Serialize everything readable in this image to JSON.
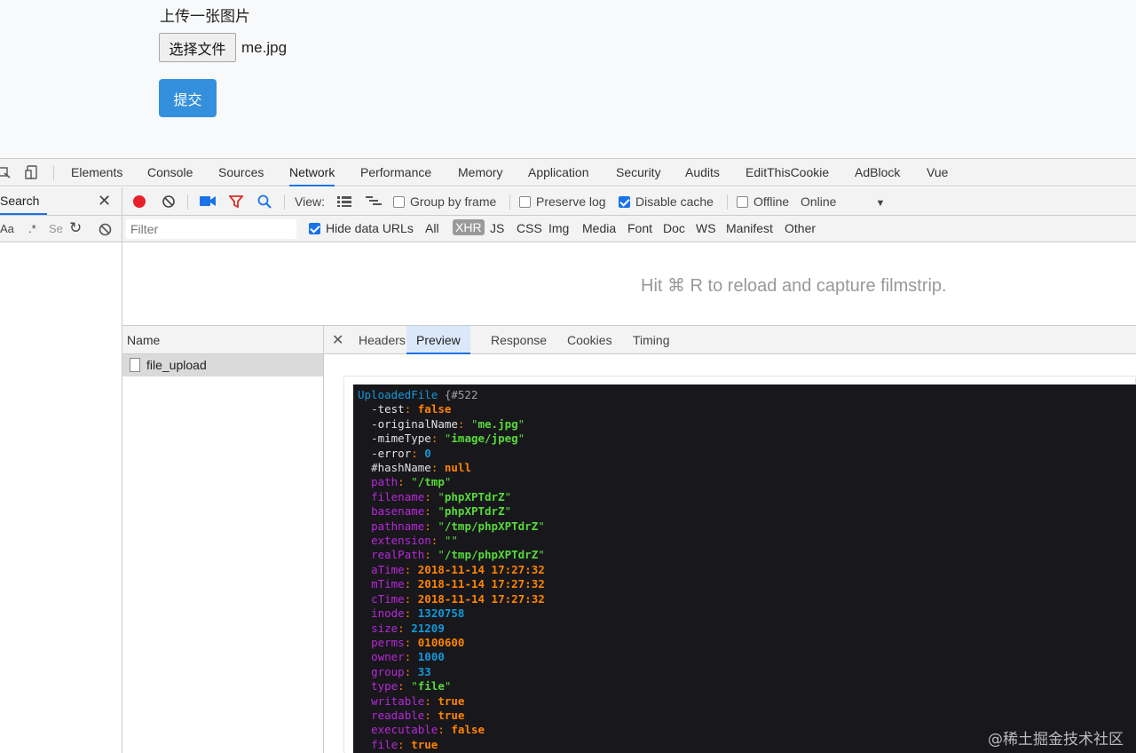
{
  "page": {
    "title": "上传一张图片",
    "file_button": "选择文件",
    "file_name": "me.jpg",
    "submit": "提交"
  },
  "devtools": {
    "tabs": [
      "Elements",
      "Console",
      "Sources",
      "Network",
      "Performance",
      "Memory",
      "Application",
      "Security",
      "Audits",
      "EditThisCookie",
      "AdBlock",
      "Vue"
    ],
    "active_tab": "Network",
    "search": {
      "title": "Search",
      "aa": "Aa",
      "regex": ".*",
      "field": "Se"
    },
    "toolbar": {
      "view_label": "View:",
      "group_by_frame": "Group by frame",
      "preserve_log": "Preserve log",
      "disable_cache": "Disable cache",
      "offline": "Offline",
      "throttle": "Online"
    },
    "filter": {
      "placeholder": "Filter",
      "hide_data_urls": "Hide data URLs",
      "types": [
        "All",
        "XHR",
        "JS",
        "CSS",
        "Img",
        "Media",
        "Font",
        "Doc",
        "WS",
        "Manifest",
        "Other"
      ],
      "active_type": "XHR"
    },
    "filmstrip_msg": "Hit ⌘ R to reload and capture filmstrip.",
    "list": {
      "header": "Name",
      "rows": [
        "file_upload"
      ]
    },
    "detail_tabs": [
      "Headers",
      "Preview",
      "Response",
      "Cookies",
      "Timing"
    ],
    "active_detail_tab": "Preview"
  },
  "dump": {
    "class_name": "UploadedFile",
    "id": "#522",
    "props": [
      {
        "prefix": "-",
        "name": "test",
        "kind": "private",
        "value": "false",
        "type": "const"
      },
      {
        "prefix": "-",
        "name": "originalName",
        "kind": "private",
        "value": "me.jpg",
        "type": "str"
      },
      {
        "prefix": "-",
        "name": "mimeType",
        "kind": "private",
        "value": "image/jpeg",
        "type": "str"
      },
      {
        "prefix": "-",
        "name": "error",
        "kind": "private",
        "value": "0",
        "type": "num"
      },
      {
        "prefix": "#",
        "name": "hashName",
        "kind": "private",
        "value": "null",
        "type": "const"
      },
      {
        "prefix": "",
        "name": "path",
        "kind": "public",
        "value": "/tmp",
        "type": "str"
      },
      {
        "prefix": "",
        "name": "filename",
        "kind": "public",
        "value": "phpXPTdrZ",
        "type": "str"
      },
      {
        "prefix": "",
        "name": "basename",
        "kind": "public",
        "value": "phpXPTdrZ",
        "type": "str"
      },
      {
        "prefix": "",
        "name": "pathname",
        "kind": "public",
        "value": "/tmp/phpXPTdrZ",
        "type": "str"
      },
      {
        "prefix": "",
        "name": "extension",
        "kind": "public",
        "value": "",
        "type": "str"
      },
      {
        "prefix": "",
        "name": "realPath",
        "kind": "public",
        "value": "/tmp/phpXPTdrZ",
        "type": "str"
      },
      {
        "prefix": "",
        "name": "aTime",
        "kind": "public",
        "value": "2018-11-14 17:27:32",
        "type": "const"
      },
      {
        "prefix": "",
        "name": "mTime",
        "kind": "public",
        "value": "2018-11-14 17:27:32",
        "type": "const"
      },
      {
        "prefix": "",
        "name": "cTime",
        "kind": "public",
        "value": "2018-11-14 17:27:32",
        "type": "const"
      },
      {
        "prefix": "",
        "name": "inode",
        "kind": "public",
        "value": "1320758",
        "type": "num"
      },
      {
        "prefix": "",
        "name": "size",
        "kind": "public",
        "value": "21209",
        "type": "num"
      },
      {
        "prefix": "",
        "name": "perms",
        "kind": "public",
        "value": "0100600",
        "type": "const"
      },
      {
        "prefix": "",
        "name": "owner",
        "kind": "public",
        "value": "1000",
        "type": "num"
      },
      {
        "prefix": "",
        "name": "group",
        "kind": "public",
        "value": "33",
        "type": "num"
      },
      {
        "prefix": "",
        "name": "type",
        "kind": "public",
        "value": "file",
        "type": "str"
      },
      {
        "prefix": "",
        "name": "writable",
        "kind": "public",
        "value": "true",
        "type": "const"
      },
      {
        "prefix": "",
        "name": "readable",
        "kind": "public",
        "value": "true",
        "type": "const"
      },
      {
        "prefix": "",
        "name": "executable",
        "kind": "public",
        "value": "false",
        "type": "const"
      },
      {
        "prefix": "",
        "name": "file",
        "kind": "public",
        "value": "true",
        "type": "const"
      }
    ]
  },
  "watermark": "@稀土掘金技术社区",
  "colors": {
    "accent": "#1a73e8",
    "submit": "#3490dc",
    "record": "#e8202a",
    "dump_bg": "#18171b"
  }
}
